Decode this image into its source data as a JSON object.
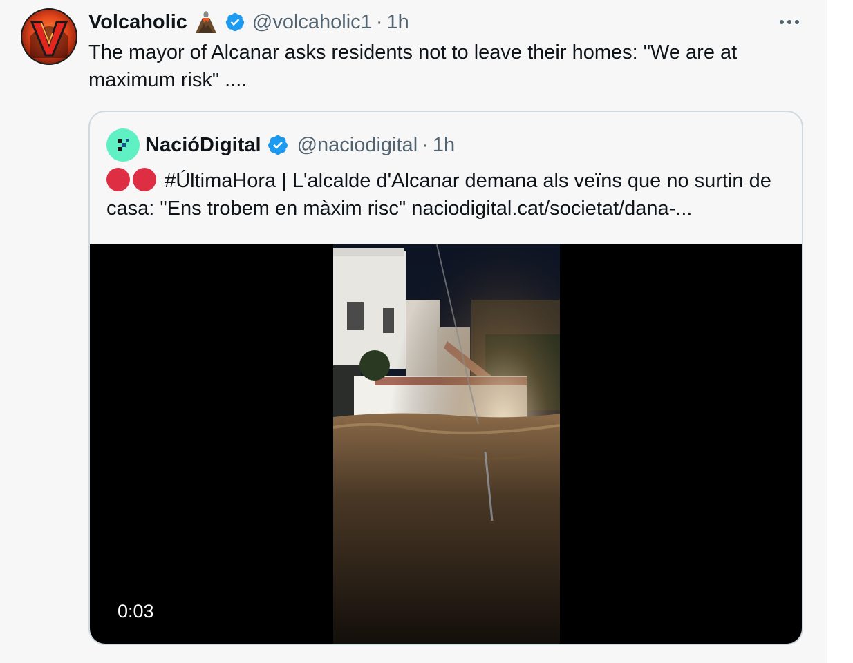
{
  "tweet": {
    "author": {
      "name": "Volcaholic",
      "handle": "@volcaholic1",
      "separator": "·",
      "time": "1h",
      "verified_color": "#1d9bf0"
    },
    "text": "The mayor of Alcanar asks residents not to leave their homes: \"We are at maximum risk\" ....",
    "quote": {
      "author": {
        "name": "NacióDigital",
        "handle": "@naciodigital",
        "separator": "·",
        "time": "1h",
        "avatar_color": "#5ff0c4"
      },
      "text": "#ÚltimaHora | L'alcalde d'Alcanar demana als veïns que no surtin de casa: \"Ens trobem en màxim risc\" naciodigital.cat/societat/dana-...",
      "media": {
        "type": "video",
        "duration": "0:03"
      }
    }
  },
  "icons": {
    "volcano": "volcano-icon",
    "verified": "verified-badge-icon",
    "more": "more-options-icon",
    "red_circle": "red-circle-emoji"
  },
  "colors": {
    "background": "#f7f7f7",
    "text": "#0f1419",
    "muted": "#536471",
    "border": "#cfd9de",
    "accent": "#1d9bf0"
  }
}
